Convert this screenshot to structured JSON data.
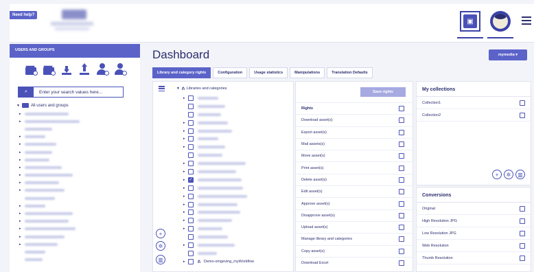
{
  "header": {
    "help_label": "Need help?",
    "menu_icon": "hamburger-icon"
  },
  "left_panel": {
    "title": "USERS AND GROUPS",
    "icons": [
      "add-folder-icon",
      "remove-folder-icon",
      "download-icon",
      "upload-icon",
      "add-user-icon",
      "remove-user-icon"
    ],
    "search": {
      "placeholder": "Enter your search values here..."
    },
    "tree_root": "All users and groups"
  },
  "main": {
    "title": "Dashboard",
    "user_menu": "mymedia ▾",
    "tabs": [
      {
        "label": "Library and category rights",
        "active": true
      },
      {
        "label": "Configuration",
        "active": false
      },
      {
        "label": "Usage statistics",
        "active": false
      },
      {
        "label": "Manipulations",
        "active": false
      },
      {
        "label": "Translation Defaults",
        "active": false
      }
    ],
    "tree_header": "Libraries and categories",
    "last_category": "Demo-omgeving_myWorkflow"
  },
  "rights": {
    "save_label": "Save rights",
    "header": "Rights",
    "items": [
      "Download asset(s)",
      "Export asset(s)",
      "Mail assets(s)",
      "Move asset(s)",
      "Print asset(s)",
      "Delete asset(s)",
      "Edit asset(s)",
      "Approve asset(s)",
      "Disapprove asset(s)",
      "Upload asset(s)",
      "Manage library and categories",
      "Copy asset(s)",
      "Download Excel"
    ]
  },
  "collections": {
    "title": "My collections",
    "items": [
      "Collection1",
      "Collection2"
    ]
  },
  "conversions": {
    "title": "Conversions",
    "items": [
      "Original",
      "High Resolution JPG",
      "Low Resolution JPG",
      "Web Resolution",
      "Thumb Resolution"
    ]
  },
  "colors": {
    "accent": "#5b63c9",
    "primary_text": "#2b2d6e",
    "save_disabled": "#a6aae0"
  }
}
